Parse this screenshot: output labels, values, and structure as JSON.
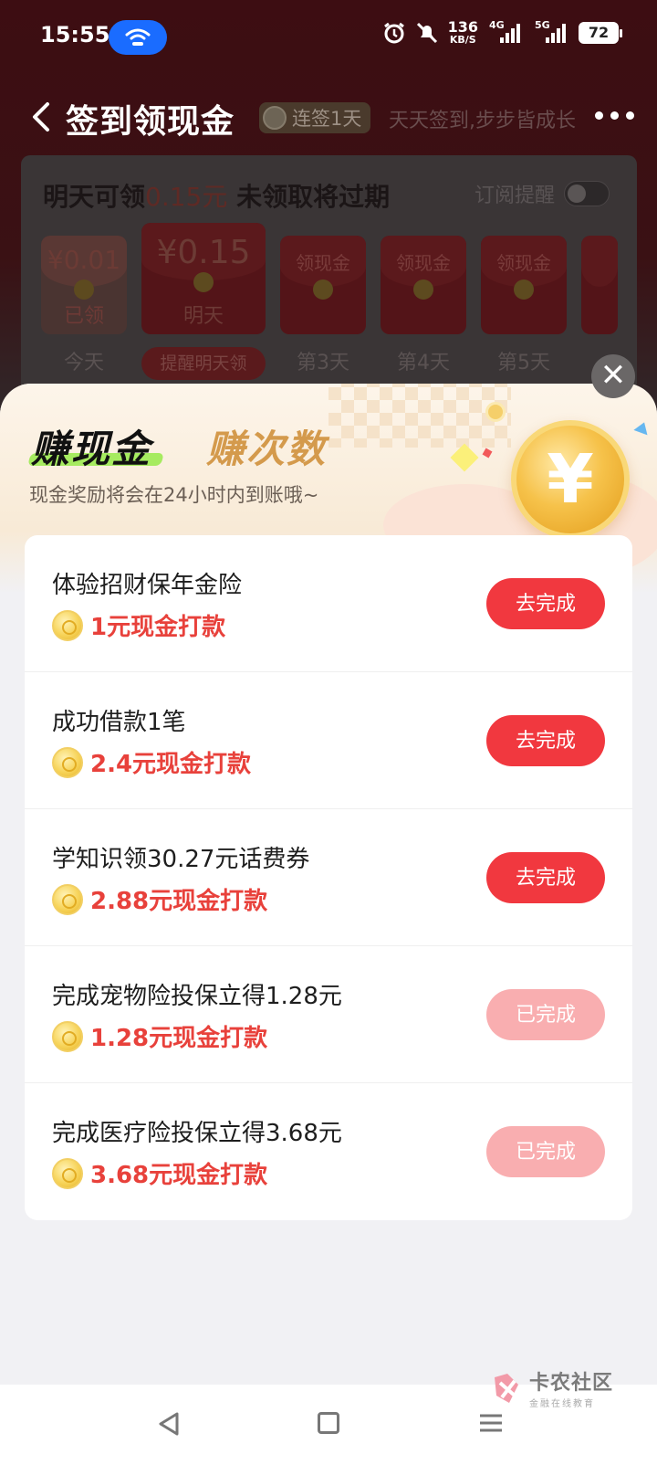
{
  "status_bar": {
    "time": "15:55",
    "speed_value": "136",
    "speed_unit": "KB/S",
    "net_4g": "4G",
    "net_5g": "5G",
    "battery": "72"
  },
  "header": {
    "title": "签到领现金",
    "streak_badge": "连签1天",
    "slogan": "天天签到,步步皆成长"
  },
  "checkin": {
    "title_prefix": "明天可领",
    "title_amount": "0.15元",
    "title_suffix": "未领取将过期",
    "subscribe_label": "订阅提醒",
    "days": [
      {
        "money": "¥0.01",
        "bottom": "已领",
        "label": "今天"
      },
      {
        "money": "¥0.15",
        "bottom": "明天",
        "label": "提醒明天领"
      },
      {
        "top": "领现金",
        "label": "第3天"
      },
      {
        "top": "领现金",
        "label": "第4天"
      },
      {
        "top": "领现金",
        "label": "第5天"
      }
    ]
  },
  "close_symbol": "✕",
  "sheet": {
    "tab_cash": "赚现金",
    "tab_count": "赚次数",
    "subtitle": "现金奖励将会在24小时内到账哦~",
    "coin_symbol": "¥"
  },
  "tasks": [
    {
      "title": "体验招财保年金险",
      "reward": "1元现金打款",
      "button": "去完成",
      "done": false
    },
    {
      "title": "成功借款1笔",
      "reward": "2.4元现金打款",
      "button": "去完成",
      "done": false
    },
    {
      "title": "学知识领30.27元话费券",
      "reward": "2.88元现金打款",
      "button": "去完成",
      "done": false
    },
    {
      "title": "完成宠物险投保立得1.28元",
      "reward": "1.28元现金打款",
      "button": "已完成",
      "done": true
    },
    {
      "title": "完成医疗险投保立得3.68元",
      "reward": "3.68元现金打款",
      "button": "已完成",
      "done": true
    }
  ],
  "watermark": {
    "main": "卡农社区",
    "sub": "金融在线教育"
  },
  "colors": {
    "accent_red": "#f1383f",
    "done_pink": "#f9aeb0",
    "reward_red": "#e8413b",
    "tab_green": "#a6eb60",
    "tab_gold": "#d49a4c"
  }
}
